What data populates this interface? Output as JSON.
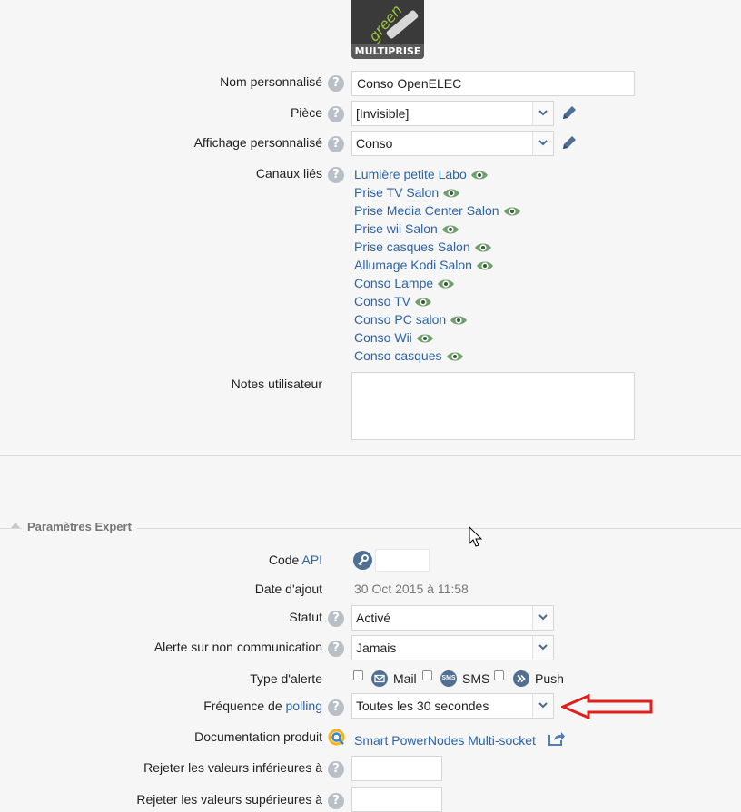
{
  "logo": {
    "brand_text": "green",
    "label": "MULTIPRISE"
  },
  "fields": {
    "name": {
      "label": "Nom personnalisé",
      "value": "Conso OpenELEC"
    },
    "room": {
      "label": "Pièce",
      "value": "[Invisible]"
    },
    "display": {
      "label": "Affichage personnalisé",
      "value": "Conso"
    },
    "channels": {
      "label": "Canaux liés",
      "items": [
        "Lumière petite Labo",
        "Prise TV Salon",
        "Prise Media Center Salon",
        "Prise wii Salon",
        "Prise casques Salon",
        "Allumage Kodi Salon",
        "Conso Lampe",
        "Conso TV",
        "Conso PC salon",
        "Conso Wii",
        "Conso casques"
      ]
    },
    "notes": {
      "label": "Notes utilisateur",
      "value": ""
    }
  },
  "expert": {
    "section_title": "Paramètres Expert",
    "api": {
      "label": "Code",
      "link": "API",
      "value": ""
    },
    "date": {
      "label": "Date d'ajout",
      "value": "30 Oct 2015 à 11:58"
    },
    "status": {
      "label": "Statut",
      "value": "Activé"
    },
    "alert_nocomm": {
      "label": "Alerte sur non communication",
      "value": "Jamais"
    },
    "alert_type": {
      "label": "Type d'alerte",
      "mail": "Mail",
      "sms": "SMS",
      "sms_icon": "SMS",
      "push": "Push"
    },
    "polling": {
      "label": "Fréquence de",
      "link": "polling",
      "value": "Toutes les 30 secondes"
    },
    "doc": {
      "label": "Documentation produit",
      "link": "Smart PowerNodes Multi-socket"
    },
    "reject_low": {
      "label": "Rejeter les valeurs inférieures à",
      "value": ""
    },
    "reject_high": {
      "label": "Rejeter les valeurs supérieures à",
      "value": ""
    }
  },
  "colors": {
    "link": "#2b63a8",
    "arrow": "#e0201c",
    "help": "#b9bfc7"
  },
  "icons": [
    "help-icon",
    "pencil-icon",
    "eye-icon",
    "key-icon",
    "mail-icon",
    "sms-icon",
    "push-icon",
    "documentation-icon",
    "external-link-icon",
    "chevron-down-icon",
    "mouse-cursor-icon",
    "red-arrow-icon"
  ]
}
